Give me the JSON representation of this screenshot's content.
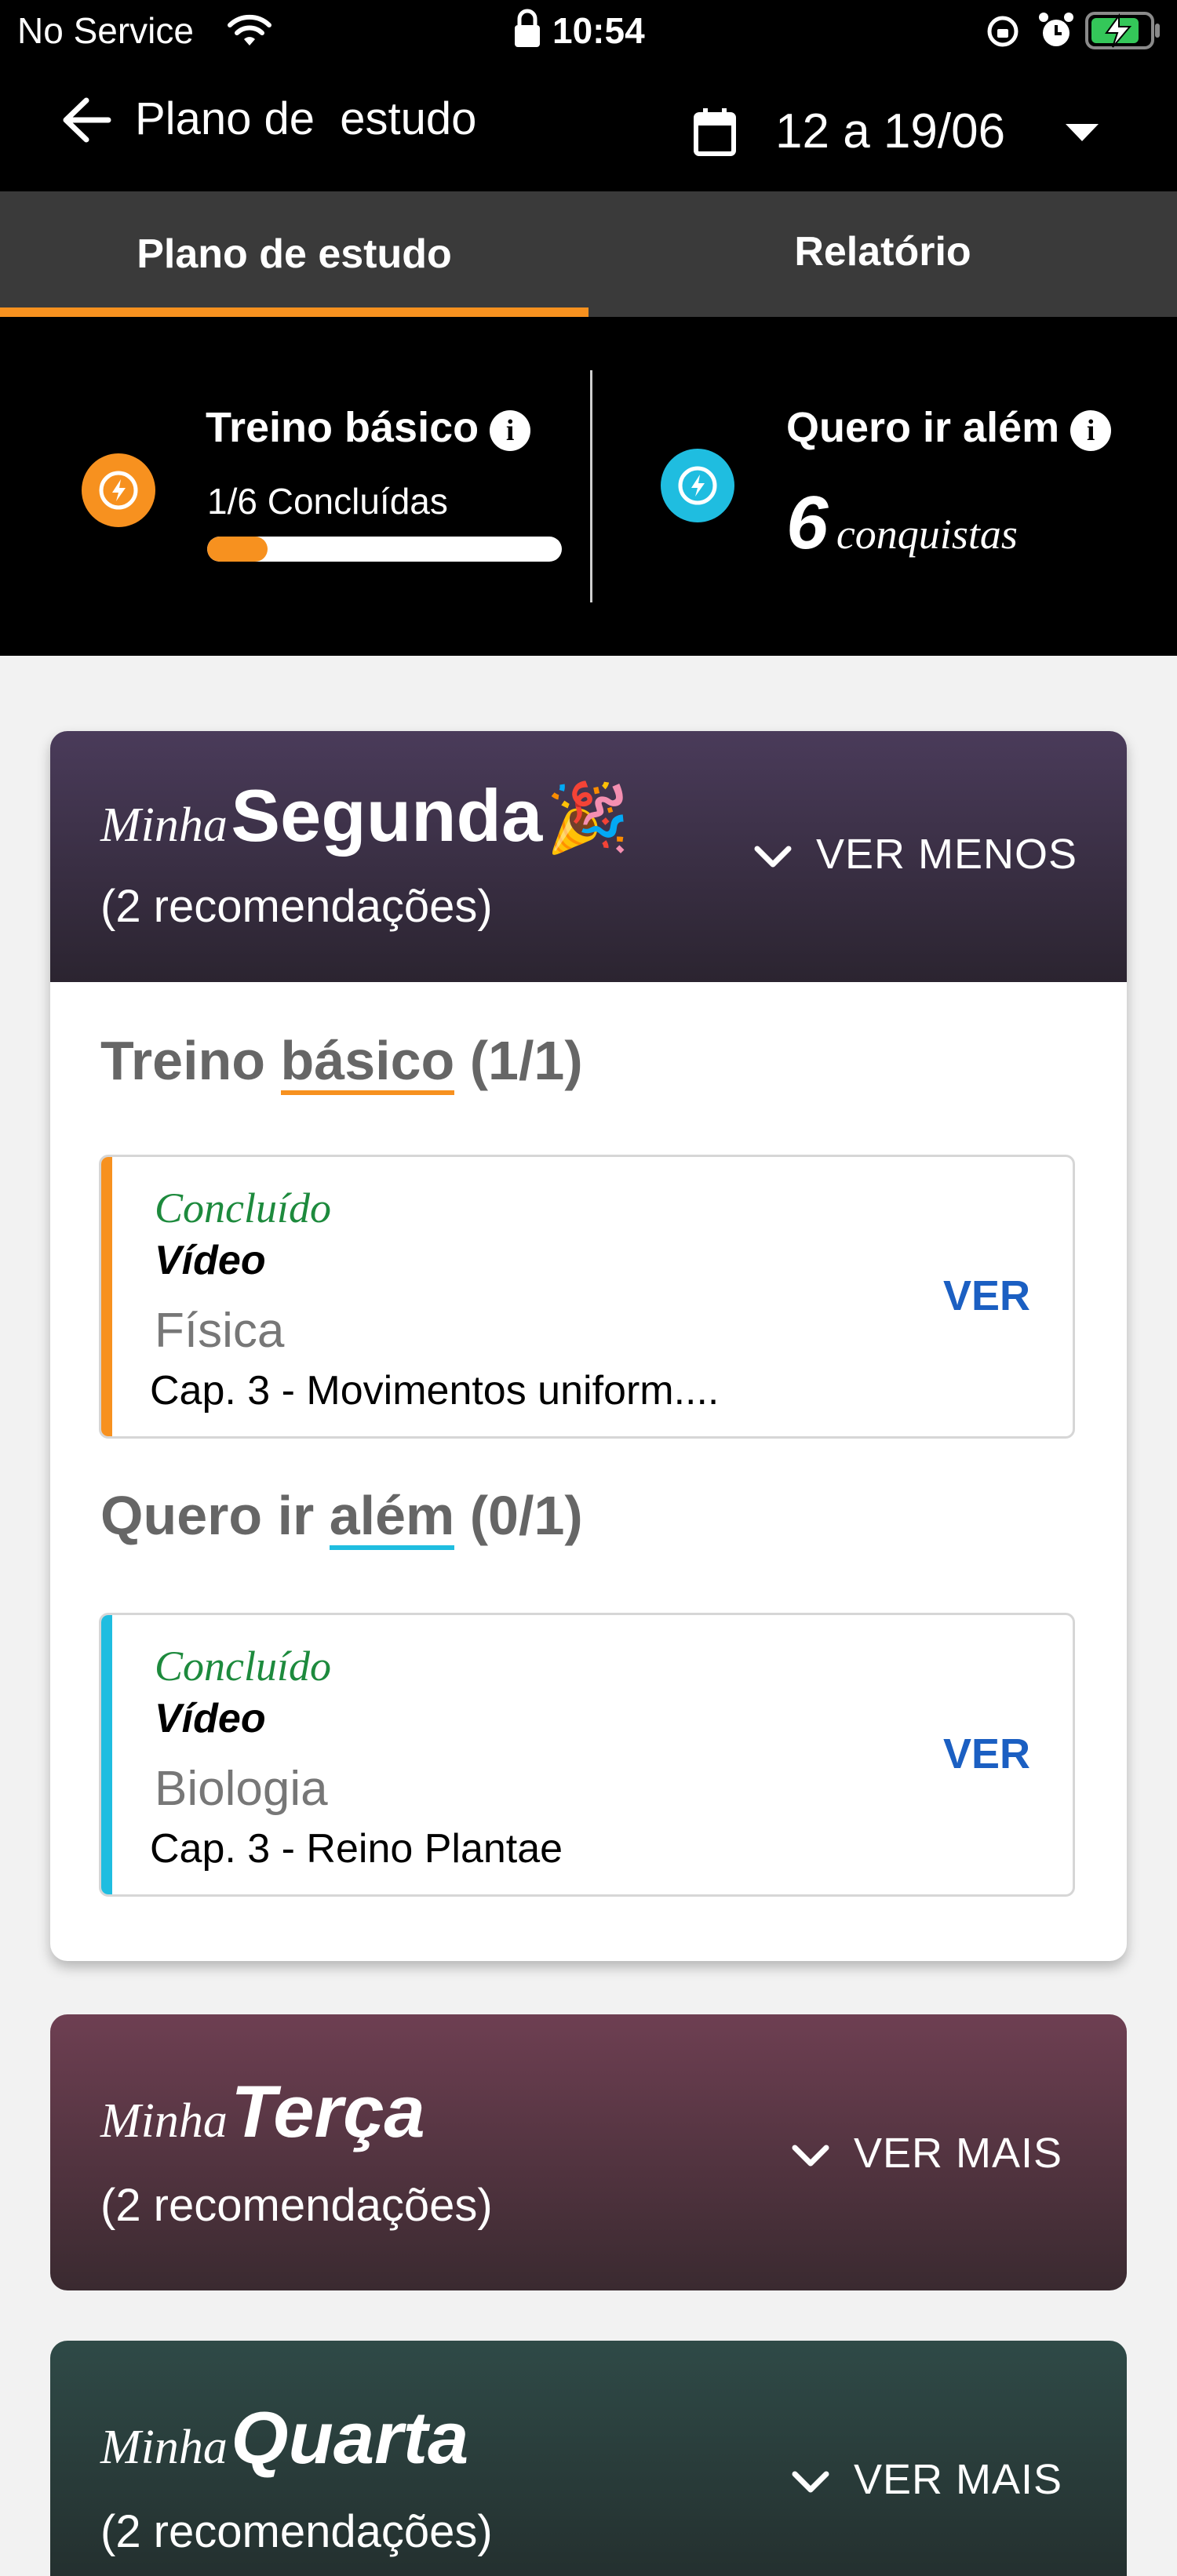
{
  "status_bar": {
    "carrier": "No Service",
    "time": "10:54",
    "wifi_icon": "wifi-icon",
    "lock_icon": "lock-icon",
    "battery_color": "#34c759"
  },
  "header": {
    "title": "Plano de  estudo",
    "date_range": "12 a 19/06"
  },
  "tabs": [
    {
      "label": "Plano de estudo",
      "active": true
    },
    {
      "label": "Relatório",
      "active": false
    }
  ],
  "summary": {
    "basic": {
      "title": "Treino básico",
      "progress_text": "1/6 Concluídas",
      "progress": 0.17,
      "color": "#f7911f"
    },
    "beyond": {
      "title": "Quero ir além",
      "count": "6",
      "count_label": "conquistas",
      "color": "#1fbde0"
    }
  },
  "days": [
    {
      "prefix": "Minha",
      "name": "Segunda",
      "emoji": "🎉",
      "recommendations": "(2 recomendações)",
      "toggle_label": "VER MENOS",
      "expanded": true,
      "sections": [
        {
          "title_start": "Treino",
          "title_underlined": "básico",
          "title_end": "(1/1)",
          "color": "#f7911f",
          "item": {
            "status": "Concluído",
            "type": "Vídeo",
            "subject": "Física",
            "chapter": "Cap. 3 - Movimentos uniform....",
            "action": "VER"
          }
        },
        {
          "title_start": "Quero ir",
          "title_underlined": "além",
          "title_end": "(0/1)",
          "color": "#1fbde0",
          "item": {
            "status": "Concluído",
            "type": "Vídeo",
            "subject": "Biologia",
            "chapter": "Cap. 3 - Reino Plantae",
            "action": "VER"
          }
        }
      ]
    },
    {
      "prefix": "Minha",
      "name": "Terça",
      "recommendations": "(2 recomendações)",
      "toggle_label": "VER MAIS",
      "expanded": false
    },
    {
      "prefix": "Minha",
      "name": "Quarta",
      "recommendations": "(2 recomendações)",
      "toggle_label": "VER MAIS",
      "expanded": false
    }
  ]
}
